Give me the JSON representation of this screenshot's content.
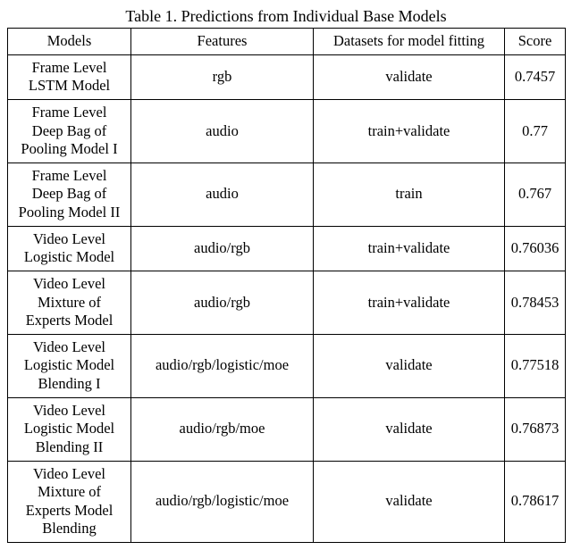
{
  "caption": "Table 1. Predictions from Individual Base Models",
  "headers": {
    "models": "Models",
    "features": "Features",
    "datasets": "Datasets for model fitting",
    "score": "Score"
  },
  "rows": [
    {
      "model_lines": [
        "Frame Level",
        "LSTM Model"
      ],
      "features": "rgb",
      "datasets": "validate",
      "score": "0.7457"
    },
    {
      "model_lines": [
        "Frame Level",
        "Deep Bag of",
        "Pooling Model I"
      ],
      "features": "audio",
      "datasets": "train+validate",
      "score": "0.77"
    },
    {
      "model_lines": [
        "Frame Level",
        "Deep Bag of",
        "Pooling Model II"
      ],
      "features": "audio",
      "datasets": "train",
      "score": "0.767"
    },
    {
      "model_lines": [
        "Video Level",
        "Logistic Model"
      ],
      "features": "audio/rgb",
      "datasets": "train+validate",
      "score": "0.76036"
    },
    {
      "model_lines": [
        "Video Level",
        "Mixture of",
        "Experts Model"
      ],
      "features": "audio/rgb",
      "datasets": "train+validate",
      "score": "0.78453"
    },
    {
      "model_lines": [
        "Video Level",
        "Logistic Model",
        "Blending I"
      ],
      "features": "audio/rgb/logistic/moe",
      "datasets": "validate",
      "score": "0.77518"
    },
    {
      "model_lines": [
        "Video Level",
        "Logistic Model",
        "Blending II"
      ],
      "features": "audio/rgb/moe",
      "datasets": "validate",
      "score": "0.76873"
    },
    {
      "model_lines": [
        "Video Level",
        "Mixture of",
        "Experts Model",
        "Blending"
      ],
      "features": "audio/rgb/logistic/moe",
      "datasets": "validate",
      "score": "0.78617"
    }
  ],
  "chart_data": {
    "type": "table",
    "title": "Table 1. Predictions from Individual Base Models",
    "columns": [
      "Models",
      "Features",
      "Datasets for model fitting",
      "Score"
    ],
    "rows": [
      [
        "Frame Level LSTM Model",
        "rgb",
        "validate",
        0.7457
      ],
      [
        "Frame Level Deep Bag of Pooling Model I",
        "audio",
        "train+validate",
        0.77
      ],
      [
        "Frame Level Deep Bag of Pooling Model II",
        "audio",
        "train",
        0.767
      ],
      [
        "Video Level Logistic Model",
        "audio/rgb",
        "train+validate",
        0.76036
      ],
      [
        "Video Level Mixture of Experts Model",
        "audio/rgb",
        "train+validate",
        0.78453
      ],
      [
        "Video Level Logistic Model Blending I",
        "audio/rgb/logistic/moe",
        "validate",
        0.77518
      ],
      [
        "Video Level Logistic Model Blending II",
        "audio/rgb/moe",
        "validate",
        0.76873
      ],
      [
        "Video Level Mixture of Experts Model Blending",
        "audio/rgb/logistic/moe",
        "validate",
        0.78617
      ]
    ]
  }
}
